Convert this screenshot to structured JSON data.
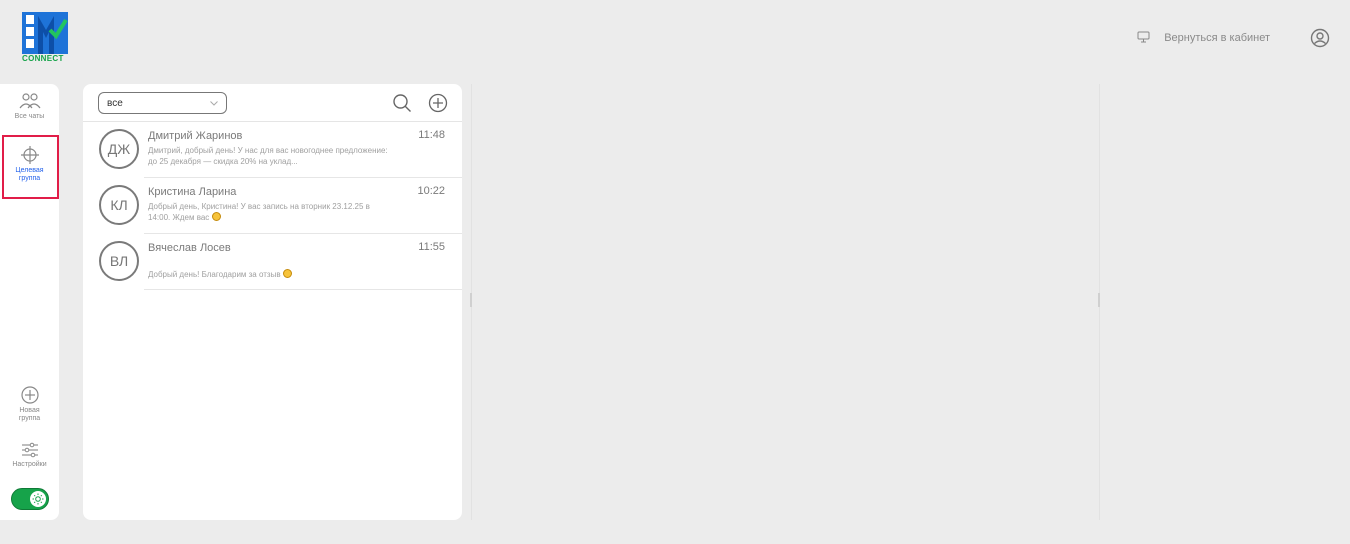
{
  "brand": {
    "connect_label": "CONNECT"
  },
  "header": {
    "back_label": "Вернуться в кабинет",
    "back_icon": "monitor-icon",
    "profile_icon": "user-circle-icon"
  },
  "sidebar": {
    "items": [
      {
        "label": "Все чаты",
        "icon": "users-icon"
      },
      {
        "label": "Целевая группа",
        "icon": "crosshair-icon"
      },
      {
        "label": "Новая группа",
        "icon": "plus-circle-icon"
      },
      {
        "label": "Настройки",
        "icon": "sliders-icon"
      }
    ],
    "theme_icon": "sun-icon"
  },
  "chat_list": {
    "filter_value": "все",
    "chats": [
      {
        "initials": "ДЖ",
        "name": "Дмитрий Жаринов",
        "time": "11:48",
        "preview": "Дмитрий, добрый день! У нас для вас новогоднее предложение: до 25 декабря — скидка 20% на уклад..."
      },
      {
        "initials": "КЛ",
        "name": "Кристина Ларина",
        "time": "10:22",
        "preview": "Добрый день, Кристина! У вас запись на вторник 23.12.25 в 14:00. Ждем вас"
      },
      {
        "initials": "ВЛ",
        "name": "Вячеслав Лосев",
        "time": "11:55",
        "preview": "Добрый день! Благодарим за отзыв"
      }
    ]
  },
  "colors": {
    "accent_blue": "#2563eb",
    "toggle_green": "#16a34a",
    "active_frame": "#e11d48"
  }
}
